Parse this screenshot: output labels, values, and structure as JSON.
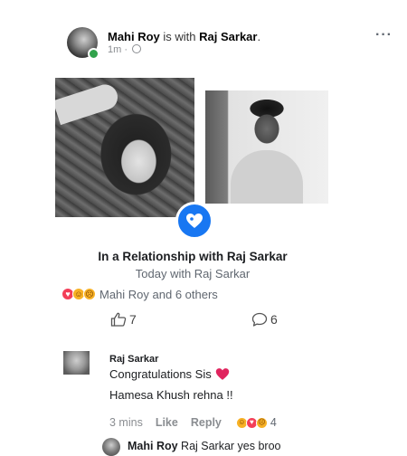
{
  "post": {
    "author": "Mahi Roy",
    "with_text": " is with ",
    "tagged": "Raj Sarkar",
    "period": ".",
    "time": "1m",
    "separator": "·",
    "more_icon": "more-horizontal-icon"
  },
  "life_event": {
    "icon": "heart-icon",
    "title": "In a Relationship with Raj Sarkar",
    "subtitle": "Today with Raj Sarkar"
  },
  "reactions": {
    "icons": [
      "love-reaction",
      "haha-reaction",
      "sad-reaction"
    ],
    "summary": "Mahi Roy and 6 others"
  },
  "counts": {
    "likes": "7",
    "comments": "6"
  },
  "comment": {
    "author": "Raj Sarkar",
    "line1": "Congratulations Sis",
    "line2": "Hamesa Khush rehna !!",
    "time": "3 mins",
    "like_label": "Like",
    "reply_label": "Reply",
    "reaction_count": "4"
  },
  "reply_preview": {
    "author": "Mahi Roy",
    "text": " Raj Sarkar yes broo"
  },
  "colors": {
    "brand_blue": "#1877f2",
    "online_green": "#31a24c",
    "love_red": "#f33e58",
    "haha_yellow": "#f7b125"
  }
}
